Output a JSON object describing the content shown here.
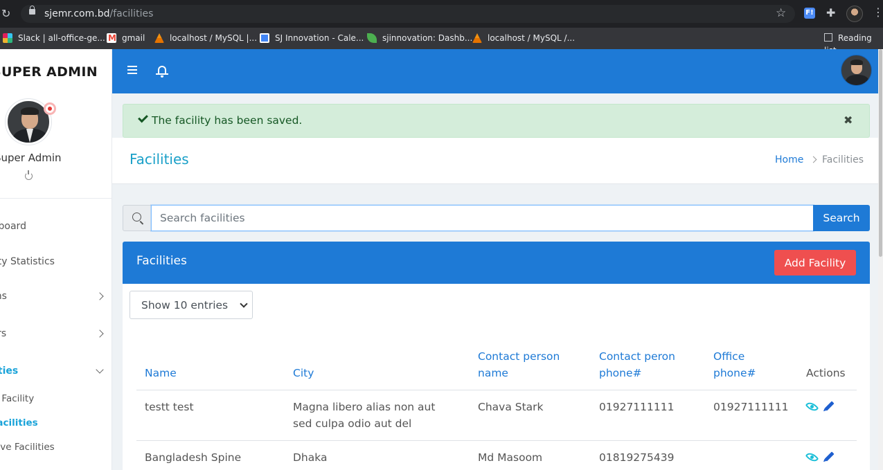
{
  "browser": {
    "url_host": "sjemr.com.bd",
    "url_path": "/facilities",
    "bookmarks": [
      {
        "label": "Slack | all-office-ge...",
        "icon": "slack-icon"
      },
      {
        "label": "gmail",
        "icon": "gmail-icon"
      },
      {
        "label": "localhost / MySQL |...",
        "icon": "phpmyadmin-icon"
      },
      {
        "label": "SJ Innovation - Cale...",
        "icon": "calendar-icon"
      },
      {
        "label": "sjinnovation: Dashb...",
        "icon": "leaf-icon"
      },
      {
        "label": "localhost / MySQL /...",
        "icon": "phpmyadmin-icon"
      }
    ],
    "reading_list": "Reading list"
  },
  "sidebar": {
    "brand": "SUPER ADMIN",
    "user_name": "Super Admin",
    "items": [
      {
        "label": "Dashboard"
      },
      {
        "label": "Facility Statistics"
      },
      {
        "label": "Admins"
      },
      {
        "label": "Doctors"
      },
      {
        "label": "Facilities"
      },
      {
        "label": "Add Facility"
      },
      {
        "label": "Facilities"
      },
      {
        "label": "Inactive Facilities"
      }
    ]
  },
  "alert": {
    "message": "The facility has been saved.",
    "close": "✖"
  },
  "page": {
    "title": "Facilities",
    "breadcrumb_home": "Home",
    "breadcrumb_current": "Facilities"
  },
  "search": {
    "placeholder": "Search facilities",
    "button": "Search"
  },
  "card": {
    "title": "Facilities",
    "add_button": "Add Facility",
    "entries_select": "Show 10 entries"
  },
  "table": {
    "headers": {
      "name": "Name",
      "city": "City",
      "contact_name_1": "Contact person",
      "contact_name_2": "name",
      "contact_phone_1": "Contact peron",
      "contact_phone_2": "phone#",
      "office_phone_1": "Office",
      "office_phone_2": "phone#",
      "actions": "Actions"
    },
    "rows": [
      {
        "name": "testt test",
        "city_1": "Magna libero alias non aut",
        "city_2": "sed culpa odio aut del",
        "contact": "Chava Stark",
        "contact_phone": "01927111111",
        "office_phone": "01927111111"
      },
      {
        "name": "Bangladesh Spine",
        "city_1": "Dhaka",
        "contact": "Md Masoom",
        "contact_phone": "01819275439",
        "office_phone": ""
      }
    ]
  },
  "colors": {
    "primary": "#1e7ad6",
    "danger": "#ef4f4f",
    "success_bg": "#d4edda",
    "accent_teal": "#1aa3d9"
  }
}
